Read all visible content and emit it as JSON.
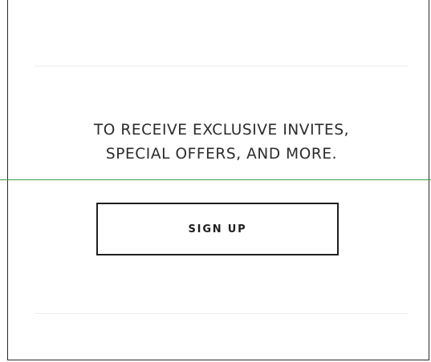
{
  "newsletter": {
    "message_line_1": "TO RECEIVE EXCLUSIVE INVITES,",
    "message_line_2": "SPECIAL OFFERS, AND MORE.",
    "button_label": "SIGN UP"
  },
  "colors": {
    "text": "#2b2b2b",
    "border": "#1f1f1f",
    "divider": "#ececec",
    "guide_line": "#3aa043",
    "background": "#ffffff"
  }
}
